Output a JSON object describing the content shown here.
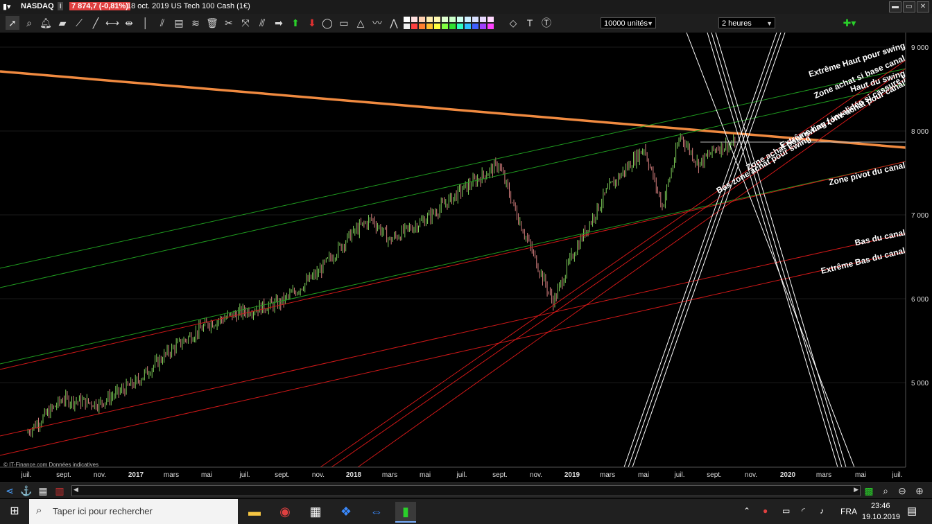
{
  "titlebar": {
    "symbol": "NASDAQ",
    "info_icon": "i",
    "price": "7 874,7 (-0,81%)",
    "description": "18 oct. 2019 US Tech 100 Cash (1€)"
  },
  "toolbar": {
    "quantity": "10000 unités",
    "timeframe": "2 heures",
    "icons": [
      "cursor-icon",
      "zoom-icon",
      "alert-bell-icon",
      "ruler-icon",
      "segment-icon",
      "trendline-icon",
      "horizontal-line-icon",
      "vertical-line-icon",
      "channel-icon",
      "fibonacci-icon",
      "gann-icon",
      "tools-icon",
      "trash-icon",
      "fan-icon",
      "channel-tool-icon",
      "arrow-right-icon",
      "arrow-up-icon",
      "arrow-down-icon",
      "ellipse-icon",
      "rectangle-icon",
      "triangle-icon",
      "wave-icon",
      "pattern-icon"
    ],
    "palette_colors": [
      "#ffffff",
      "#ffe0e0",
      "#ffd0b0",
      "#ffeeb0",
      "#fff8b0",
      "#e0ffd0",
      "#c8ffc8",
      "#d0fff0",
      "#d0f0ff",
      "#d8e0ff",
      "#e8d8ff",
      "#ffd8ff",
      "#f0f0f0",
      "#ff4040",
      "#ff8030",
      "#ffc030",
      "#ffff40",
      "#80ff40",
      "#30e030",
      "#30ffc0",
      "#30c0ff",
      "#4060ff",
      "#a040ff",
      "#ff40ff"
    ]
  },
  "chart": {
    "watermark": "© IT-Finance.com  Données indicatives",
    "y_ticks": [
      "9 000",
      "8 000",
      "7 000",
      "6 000",
      "5 000"
    ],
    "x_ticks": [
      "juil.",
      "sept.",
      "nov.",
      "2017",
      "mars",
      "mai",
      "juil.",
      "sept.",
      "nov.",
      "2018",
      "mars",
      "mai",
      "juil.",
      "sept.",
      "nov.",
      "2019",
      "mars",
      "mai",
      "juil.",
      "sept.",
      "nov.",
      "2020",
      "mars",
      "mai",
      "juil."
    ],
    "annotations": [
      "Extrême Haut pour swing",
      "Zone achat si base canal",
      "Haut du swing",
      "Zone achat pour swing ( invalidée si cassure )",
      "Extrême bas zone achat pour canal",
      "Bas zone achat pour swing",
      "Zone pivot du canal",
      "Bas du canal",
      "Extrême Bas du canal"
    ],
    "colors": {
      "orange": "#f08a40",
      "red": "#d01818",
      "green": "#1f9a1f",
      "white": "#ffffff",
      "up": "#7fd05a",
      "down": "#d88080"
    }
  },
  "chart_data": {
    "type": "line",
    "title": "",
    "x": [
      "2016-07",
      "2016-09",
      "2016-11",
      "2017-01",
      "2017-03",
      "2017-05",
      "2017-07",
      "2017-09",
      "2017-11",
      "2018-01",
      "2018-02",
      "2018-03",
      "2018-05",
      "2018-07",
      "2018-09",
      "2018-10",
      "2018-12",
      "2019-01",
      "2019-03",
      "2019-05",
      "2019-06",
      "2019-07",
      "2019-08",
      "2019-09",
      "2019-10"
    ],
    "series": [
      {
        "values": [
          4400,
          4800,
          4750,
          5000,
          5400,
          5700,
          5850,
          5950,
          6300,
          6800,
          6950,
          6700,
          6950,
          7300,
          7600,
          7000,
          5950,
          6500,
          7300,
          7800,
          7100,
          7950,
          7600,
          7800,
          7850
        ]
      }
    ],
    "ylim": [
      4000,
      9000
    ],
    "xlabel": "",
    "ylabel": "",
    "grid": true
  },
  "bottombar": {
    "icons": [
      "share-icon",
      "anchor-icon",
      "indicator-icon",
      "compare-icon",
      "scroll-left-icon",
      "scroll-right-icon",
      "indicators-icon",
      "zoom-fit-icon",
      "zoom-out-icon",
      "zoom-in-icon"
    ]
  },
  "taskbar": {
    "search_placeholder": "Taper ici pour rechercher",
    "apps": [
      "file-explorer-icon",
      "chrome-icon",
      "calculator-icon",
      "dropbox-icon",
      "teamviewer-icon",
      "trading-app-icon"
    ],
    "language": "FRA",
    "time": "23:46",
    "date": "19.10.2019"
  }
}
